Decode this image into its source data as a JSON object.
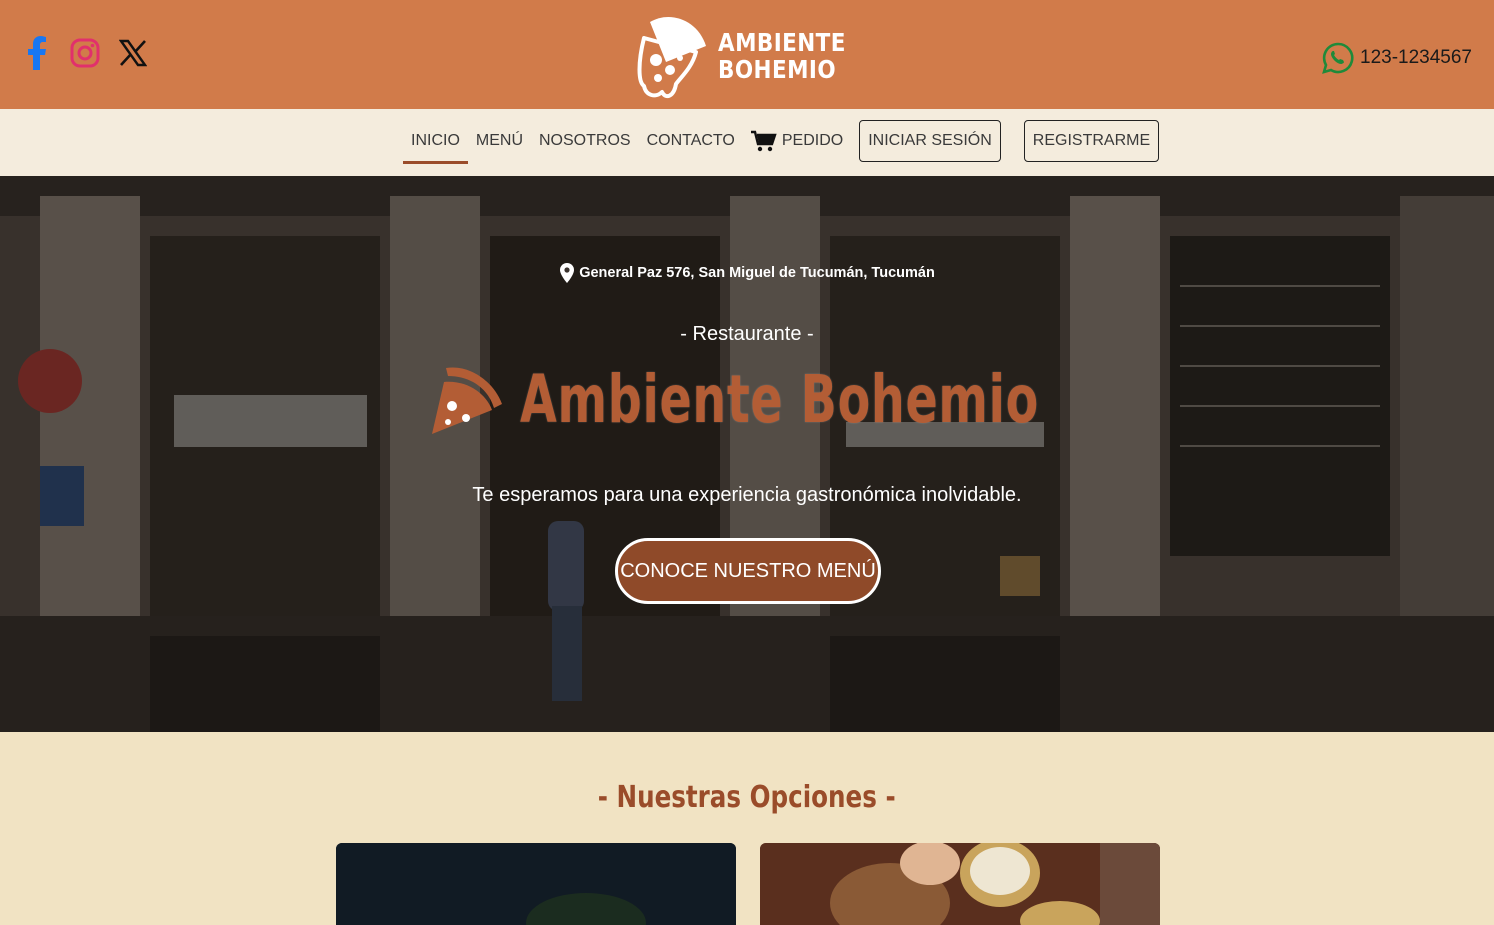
{
  "header": {
    "logo_line1": "AMBIENTE",
    "logo_line2": "BOHEMIO",
    "phone": "123-1234567",
    "social": [
      "facebook-icon",
      "instagram-icon",
      "x-icon"
    ]
  },
  "nav": {
    "links": [
      {
        "label": "INICIO",
        "active": true
      },
      {
        "label": "MENÚ"
      },
      {
        "label": "NOSOTROS"
      },
      {
        "label": "CONTACTO"
      },
      {
        "label": "PEDIDO",
        "icon": "cart-icon"
      }
    ],
    "login_label": "INICIAR SESIÓN",
    "register_label": "REGISTRARME"
  },
  "hero": {
    "address": "General Paz 576, San Miguel de Tucumán, Tucumán",
    "subtitle": "- Restaurante -",
    "title": "Ambiente Bohemio",
    "tagline": "Te esperamos para una experiencia gastronómica inolvidable.",
    "cta_label": "CONOCE NUESTRO MENÚ"
  },
  "section": {
    "title": "- Nuestras Opciones -"
  },
  "colors": {
    "header_bg": "#d17b4a",
    "nav_bg": "#f4ecdd",
    "page_bg": "#f1e3c3",
    "accent": "#9a4c2a",
    "cta_bg": "#8f4a29"
  }
}
